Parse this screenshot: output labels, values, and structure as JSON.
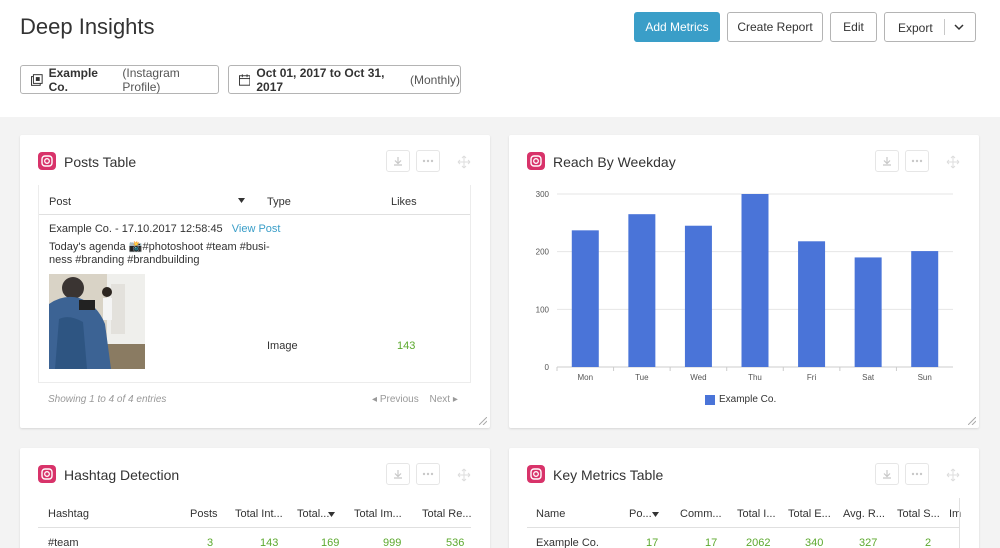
{
  "header": {
    "title": "Deep Insights",
    "buttons": {
      "add_metrics": "Add Metrics",
      "create_report": "Create Report",
      "edit": "Edit",
      "export": "Export"
    }
  },
  "filters": {
    "profile": {
      "name": "Example Co.",
      "type": "(Instagram Profile)"
    },
    "date": {
      "range": "Oct 01, 2017 to Oct 31, 2017",
      "period": "(Monthly)"
    }
  },
  "posts_table": {
    "title": "Posts Table",
    "columns": [
      "Post",
      "Type",
      "Likes"
    ],
    "row": {
      "meta": "Example Co. - 17.10.2017 12:58:45",
      "link": "View Post",
      "caption_line1": "Today's agenda 📸#photoshoot #team #busi-",
      "caption_line2": "ness #branding #brandbuilding",
      "type": "Image",
      "likes": "143"
    },
    "footer": "Showing 1 to 4 of 4 entries",
    "prev": "Previous",
    "next": "Next"
  },
  "reach_chart": {
    "title": "Reach By Weekday",
    "legend": "Example Co."
  },
  "chart_data": {
    "type": "bar",
    "title": "Reach By Weekday",
    "categories": [
      "Mon",
      "Tue",
      "Wed",
      "Thu",
      "Fri",
      "Sat",
      "Sun"
    ],
    "series": [
      {
        "name": "Example Co.",
        "values": [
          237,
          265,
          245,
          300,
          218,
          190,
          201
        ],
        "color": "#4a74d8"
      }
    ],
    "yticks": [
      "0",
      "100",
      "200",
      "300"
    ],
    "ylim": [
      0,
      300
    ],
    "grid": true,
    "legend_position": "bottom"
  },
  "hashtag_table": {
    "title": "Hashtag Detection",
    "columns": [
      "Hashtag",
      "Posts",
      "Total Int...",
      "Total...",
      "Total Im...",
      "Total Re..."
    ],
    "row": [
      "#team",
      "3",
      "143",
      "169",
      "999",
      "536"
    ]
  },
  "key_metrics_table": {
    "title": "Key Metrics Table",
    "columns": [
      "Name",
      "Po...",
      "Comm...",
      "Total I...",
      "Total E...",
      "Avg. R...",
      "Total S...",
      "Im"
    ],
    "row": [
      "Example Co.",
      "17",
      "17",
      "2062",
      "340",
      "327",
      "2"
    ]
  },
  "colors": {
    "accent": "#3a9ec8",
    "brand": "#d8336a",
    "bar": "#4a74d8",
    "positive": "#5ca92e"
  }
}
